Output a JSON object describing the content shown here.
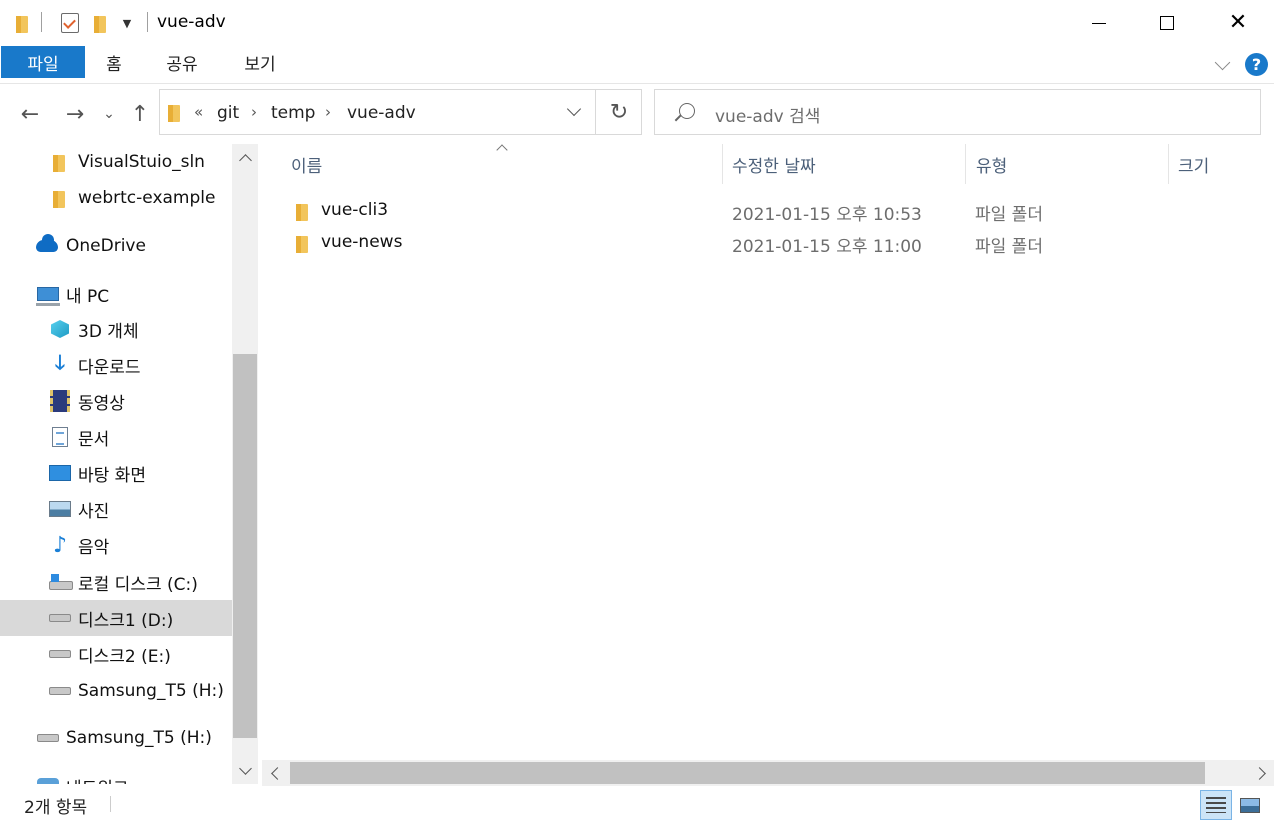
{
  "window": {
    "title": "vue-adv",
    "minimize_symbol": "",
    "close_symbol": "✕"
  },
  "ribbon": {
    "tabs": [
      {
        "label": "파일",
        "active": true
      },
      {
        "label": "홈",
        "active": false
      },
      {
        "label": "공유",
        "active": false
      },
      {
        "label": "보기",
        "active": false
      }
    ],
    "help_symbol": "?"
  },
  "navigation": {
    "back_symbol": "←",
    "forward_symbol": "→",
    "recent_symbol": "⌄",
    "up_symbol": "↑",
    "overflow_symbol": "«",
    "breadcrumb": [
      "git",
      "temp",
      "vue-adv"
    ],
    "separator_symbol": "›",
    "refresh_symbol": "↻"
  },
  "search": {
    "placeholder": "vue-adv 검색"
  },
  "sidebar": {
    "items": [
      {
        "label": "VisualStuio_sln",
        "icon": "folder-icon"
      },
      {
        "label": "webrtc-example",
        "icon": "folder-icon"
      },
      {
        "label": "OneDrive",
        "icon": "onedrive-cloud-icon"
      },
      {
        "label": "내 PC",
        "icon": "computer-icon"
      },
      {
        "label": "3D 개체",
        "icon": "3d-objects-icon"
      },
      {
        "label": "다운로드",
        "icon": "download-icon"
      },
      {
        "label": "동영상",
        "icon": "video-icon"
      },
      {
        "label": "문서",
        "icon": "document-icon"
      },
      {
        "label": "바탕 화면",
        "icon": "desktop-icon"
      },
      {
        "label": "사진",
        "icon": "pictures-icon"
      },
      {
        "label": "음악",
        "icon": "music-icon"
      },
      {
        "label": "로컬 디스크 (C:)",
        "icon": "windows-drive-icon"
      },
      {
        "label": "디스크1 (D:)",
        "icon": "drive-icon",
        "selected": true
      },
      {
        "label": "디스크2 (E:)",
        "icon": "drive-icon"
      },
      {
        "label": "Samsung_T5 (H:)",
        "icon": "drive-icon"
      },
      {
        "label": "Samsung_T5 (H:)",
        "icon": "drive-icon"
      },
      {
        "label": "네트워크",
        "icon": "network-icon"
      }
    ]
  },
  "list": {
    "columns": [
      "이름",
      "수정한 날짜",
      "유형",
      "크기"
    ],
    "rows": [
      {
        "name": "vue-cli3",
        "modified": "2021-01-15 오후 10:53",
        "type": "파일 폴더",
        "size": ""
      },
      {
        "name": "vue-news",
        "modified": "2021-01-15 오후 11:00",
        "type": "파일 폴더",
        "size": ""
      }
    ]
  },
  "status": {
    "item_count": "2개 항목"
  },
  "colors": {
    "accent": "#1979ca",
    "folder": "#f2c55c",
    "selected_row": "#d9d9d9"
  }
}
